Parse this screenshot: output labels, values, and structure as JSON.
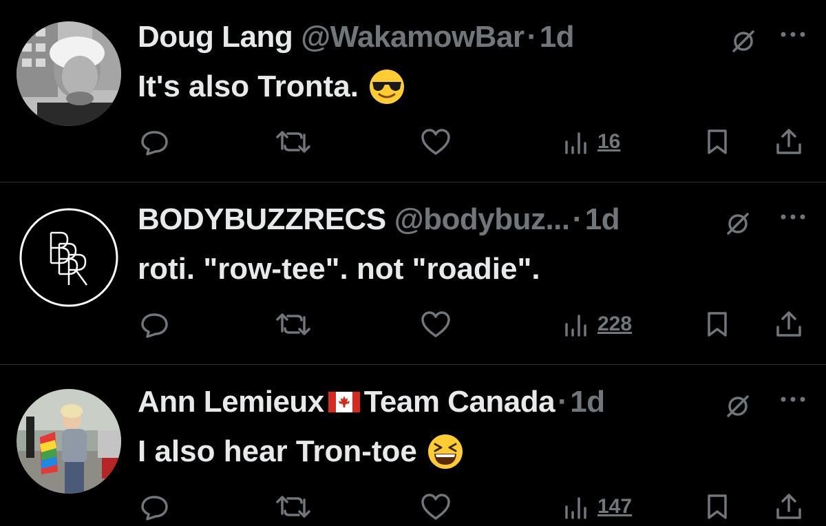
{
  "tweets": [
    {
      "name": "Doug Lang",
      "handle": "@WakamowBar",
      "separator": "·",
      "time": "1d",
      "text": "It's also Tronta.",
      "emoji": "smiling-face-with-sunglasses",
      "views": "16",
      "avatar": "photo-grayscale-man"
    },
    {
      "name": "BODYBUZZRECS",
      "handle": "@bodybuz...",
      "separator": "·",
      "time": "1d",
      "text": "roti. \"row-tee\". not \"roadie\".",
      "views": "228",
      "avatar": "BBR-monogram-logo"
    },
    {
      "name": "Ann Lemieux",
      "name_suffix": "Team Canada",
      "flag": "canada-flag",
      "separator": "·",
      "time": "1d",
      "text": "I also hear Tron-toe",
      "emoji": "grinning-squinting-face",
      "views": "147",
      "avatar": "photo-woman-with-flag"
    }
  ],
  "colors": {
    "background": "#000000",
    "text": "#e7e9ea",
    "muted": "#71767b",
    "divider": "#2f3336"
  }
}
